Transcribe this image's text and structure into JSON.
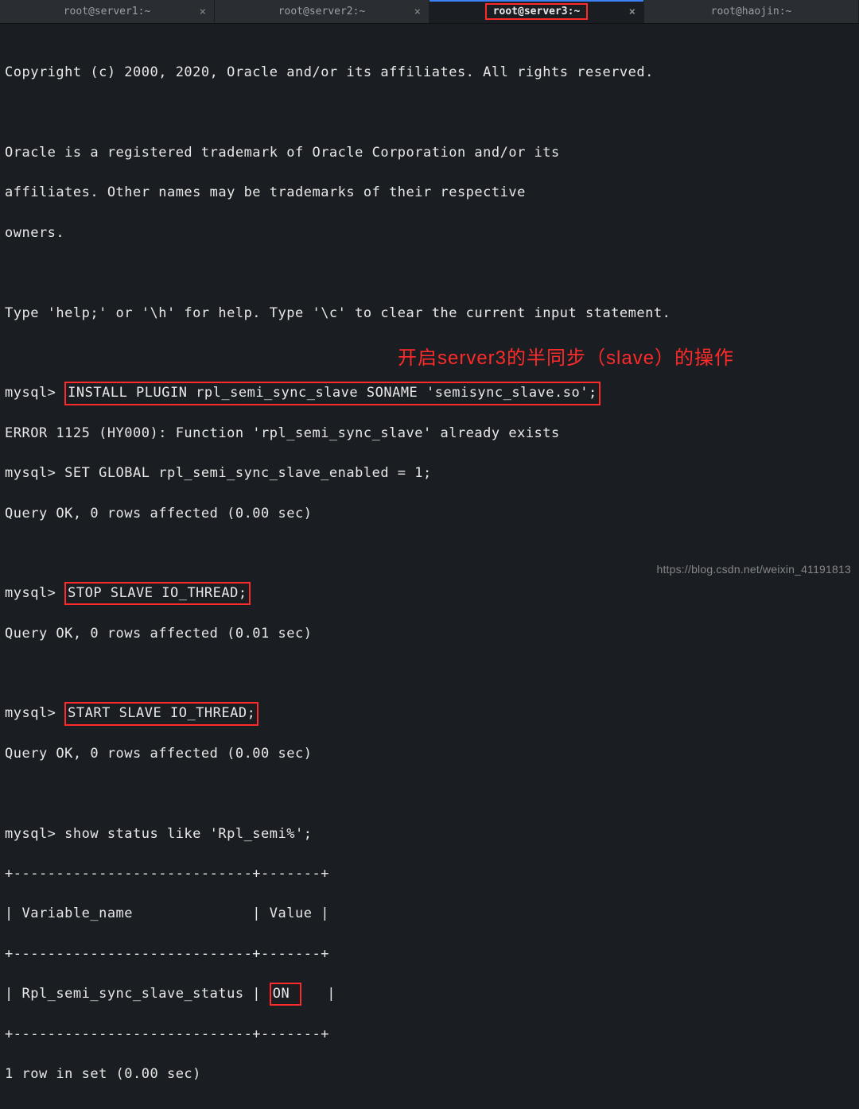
{
  "tabs": [
    {
      "title": "root@server1:~",
      "active": false
    },
    {
      "title": "root@server2:~",
      "active": false
    },
    {
      "title": "root@server3:~",
      "active": true
    },
    {
      "title": "root@haojin:~",
      "active": false
    }
  ],
  "close_glyph": "×",
  "copy_line1": "Copyright (c) 2000, 2020, Oracle and/or its affiliates. All rights reserved.",
  "trademark_l1": "Oracle is a registered trademark of Oracle Corporation and/or its",
  "trademark_l2": "affiliates. Other names may be trademarks of their respective",
  "trademark_l3": "owners.",
  "help_line": "Type 'help;' or '\\h' for help. Type '\\c' to clear the current input statement.",
  "p1_prompt": "mysql> ",
  "p1_cmd": "INSTALL PLUGIN rpl_semi_sync_slave SONAME 'semisync_slave.so';",
  "err_line": "ERROR 1125 (HY000): Function 'rpl_semi_sync_slave' already exists",
  "p2": "mysql> SET GLOBAL rpl_semi_sync_slave_enabled = 1;",
  "q_ok_000": "Query OK, 0 rows affected (0.00 sec)",
  "p3_prompt": "mysql> ",
  "p3_cmd": "STOP SLAVE IO_THREAD;",
  "q_ok_001": "Query OK, 0 rows affected (0.01 sec)",
  "p4_prompt": "mysql> ",
  "p4_cmd": "START SLAVE IO_THREAD;",
  "p5": "mysql> show status like 'Rpl_semi%';",
  "tbl_border": "+----------------------------+-------+",
  "tbl_header": "| Variable_name              | Value |",
  "tbl_row_pre": "| Rpl_semi_sync_slave_status | ",
  "tbl_row_val": "ON ",
  "tbl_row_post": "   |",
  "rowcount": "1 row in set (0.00 sec)",
  "annotation_text": "开启server3的半同步（slave）的操作",
  "watermark": "https://blog.csdn.net/weixin_41191813"
}
